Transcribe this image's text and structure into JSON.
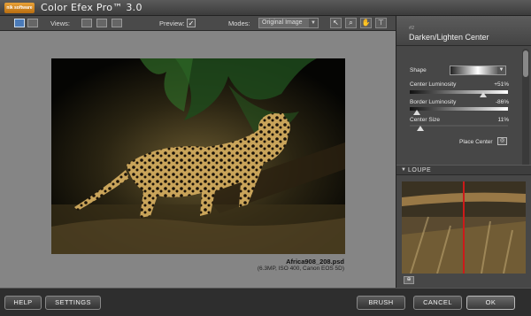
{
  "app": {
    "logo_text": "nik software",
    "title": "Color Efex Pro™ 3.0"
  },
  "toolbar": {
    "views_label": "Views:",
    "preview_label": "Preview:",
    "preview_checked": "✓",
    "modes_label": "Modes:",
    "modes_value": "Original Image"
  },
  "image": {
    "filename": "Africa908_208.psd",
    "meta": "(6.3MP, ISO 400, Canon EOS 5D)"
  },
  "filter": {
    "number": "#2",
    "name": "Darken/Lighten Center",
    "shape_label": "Shape",
    "params": [
      {
        "label": "Center Luminosity",
        "value": "+51%",
        "level": 0.75
      },
      {
        "label": "Border Luminosity",
        "value": "-86%",
        "level": 0.07
      },
      {
        "label": "Center Size",
        "value": "11%",
        "level": 0.11
      }
    ],
    "place_center_label": "Place Center"
  },
  "loupe": {
    "title": "LOUPE"
  },
  "buttons": {
    "help": "HELP",
    "settings": "SETTINGS",
    "brush": "BRUSH",
    "cancel": "CANCEL",
    "ok": "OK"
  }
}
